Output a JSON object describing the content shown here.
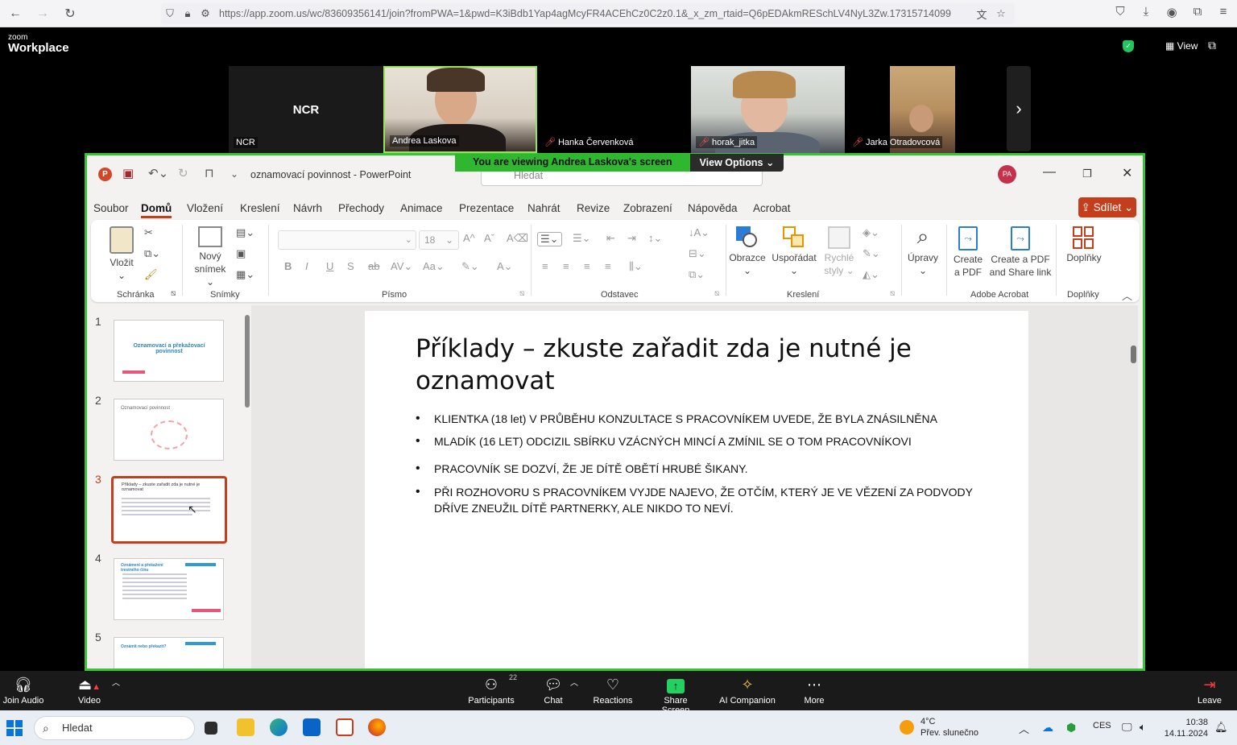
{
  "browser": {
    "url": "https://app.zoom.us/wc/83609356141/join?fromPWA=1&pwd=K3iBdb1Yap4agMcyFR4ACEhCz0C2z0.1&_x_zm_rtaid=Q6pEDAkmRESchLV4NyL3Zw.17315714099"
  },
  "zoom": {
    "logo_top": "zoom",
    "logo_bottom": "Workplace",
    "view_label": "View",
    "participants": [
      {
        "name": "NCR",
        "avatar_text": "NCR",
        "muted": false,
        "video": false
      },
      {
        "name": "Andrea Laskova",
        "muted": false,
        "video": true,
        "active": true
      },
      {
        "name": "Hanka Červenková",
        "muted": true,
        "video": false
      },
      {
        "name": "horak_jitka",
        "muted": true,
        "video": true
      },
      {
        "name": "Jarka Otradovcová",
        "muted": true,
        "video": true
      }
    ],
    "viewing_banner": "You are viewing  Andrea Laskova's screen",
    "view_options": "View Options",
    "controls": {
      "join_audio": "Join Audio",
      "video": "Video",
      "participants": "Participants",
      "participants_count": "22",
      "chat": "Chat",
      "reactions": "Reactions",
      "share_screen": "Share Screen",
      "ai_companion": "AI Companion",
      "more": "More",
      "leave": "Leave"
    }
  },
  "powerpoint": {
    "doc_title": "oznamovací povinnost  -  PowerPoint",
    "search_placeholder": "Hledat",
    "avatar": "PA",
    "share_btn": "Sdílet",
    "tabs": [
      "Soubor",
      "Domů",
      "Vložení",
      "Kreslení",
      "Návrh",
      "Přechody",
      "Animace",
      "Prezentace",
      "Nahrát",
      "Revize",
      "Zobrazení",
      "Nápověda",
      "Acrobat"
    ],
    "ribbon": {
      "vlozit": "Vložit",
      "schranka": "Schránka",
      "novy": "Nový",
      "snimek": "snímek",
      "snimky": "Snímky",
      "font_size": "18",
      "pismo": "Písmo",
      "odstavec": "Odstavec",
      "obrazce": "Obrazce",
      "usporadat": "Uspořádat",
      "rychle1": "Rychlé",
      "rychle2": "styly",
      "kresleni": "Kreslení",
      "upravy": "Úpravy",
      "create_pdf_1": "Create",
      "create_pdf_2": "a PDF",
      "share_pdf_1": "Create a PDF",
      "share_pdf_2": "and Share link",
      "adobe": "Adobe Acrobat",
      "doplnky": "Doplňky",
      "doplnky_group": "Doplňky"
    },
    "thumbnails": [
      {
        "num": "1",
        "title": "Oznamovací a překažovací povinnost"
      },
      {
        "num": "2",
        "title": "Oznamovací povinnost"
      },
      {
        "num": "3",
        "title": "Příklady – zkuste zařadit zda je nutné je oznamovat"
      },
      {
        "num": "4",
        "title": "Oznámení a překažení trestného činu"
      },
      {
        "num": "5",
        "title": "Oznámit nebo překazit?"
      }
    ],
    "slide": {
      "title": "Příklady – zkuste zařadit zda je nutné je oznamovat",
      "bullets": [
        "KLIENTKA (18 let) V PRŮBĚHU KONZULTACE S PRACOVNÍKEM UVEDE, ŽE BYLA ZNÁSILNĚNA",
        "MLADÍK (16 LET)  ODCIZIL SBÍRKU VZÁCNÝCH MINCÍ A ZMÍNIL SE O TOM PRACOVNÍKOVI",
        " PRACOVNÍK SE DOZVÍ, ŽE JE DÍTĚ OBĚTÍ HRUBÉ ŠIKANY.",
        "PŘI ROZHOVORU S PRACOVNÍKEM VYJDE NAJEVO, ŽE OTČÍM, KTERÝ JE VE VĚZENÍ ZA PODVODY DŘÍVE ZNEUŽIL DÍTĚ PARTNERKY, ALE NIKDO TO NEVÍ."
      ]
    }
  },
  "taskbar": {
    "search": "Hledat",
    "temp": "4°C",
    "weather": "Přev. slunečno",
    "lang": "CES",
    "time": "10:38",
    "date": "14.11.2024"
  },
  "colors": {
    "zoom_green": "#38c534",
    "ppt_accent": "#c43e1c",
    "share_green": "#23d160"
  }
}
